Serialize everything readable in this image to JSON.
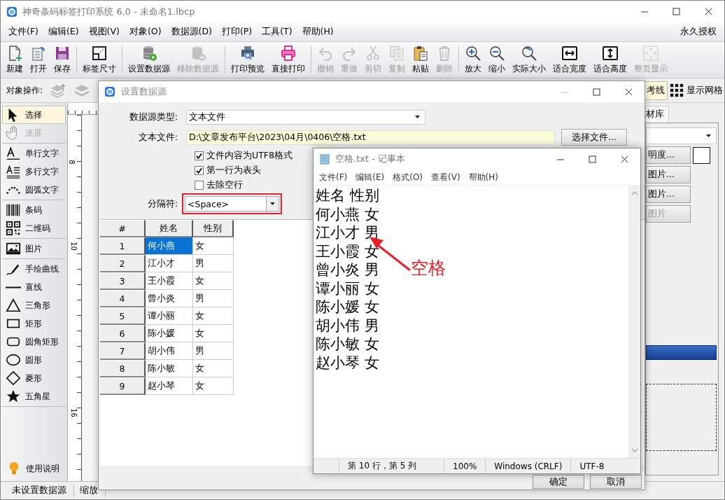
{
  "window": {
    "title": "神奇条码标签打印系统 6.0 - 未命名1.lbcp"
  },
  "menu": {
    "items": [
      "文件(F)",
      "编辑(E)",
      "视图(V)",
      "对象(O)",
      "数据源(D)",
      "打印(P)",
      "工具(T)",
      "帮助(H)"
    ],
    "license": "永久授权"
  },
  "toolbar": {
    "groups": [
      [
        {
          "label": "新建",
          "disabled": false
        },
        {
          "label": "打开",
          "disabled": false
        },
        {
          "label": "保存",
          "disabled": false
        }
      ],
      [
        {
          "label": "标签尺寸",
          "disabled": false
        }
      ],
      [
        {
          "label": "设置数据源",
          "disabled": false
        },
        {
          "label": "移除数据源",
          "disabled": true
        }
      ],
      [
        {
          "label": "打印预览",
          "disabled": false
        },
        {
          "label": "直接打印",
          "disabled": false
        }
      ],
      [
        {
          "label": "撤销",
          "disabled": true
        },
        {
          "label": "重做",
          "disabled": true
        },
        {
          "label": "剪切",
          "disabled": true
        },
        {
          "label": "复制",
          "disabled": true
        },
        {
          "label": "粘贴",
          "disabled": false
        },
        {
          "label": "删除",
          "disabled": true
        }
      ],
      [
        {
          "label": "放大",
          "disabled": false
        },
        {
          "label": "缩小",
          "disabled": false
        },
        {
          "label": "实际大小",
          "disabled": false
        },
        {
          "label": "适合宽度",
          "disabled": false
        },
        {
          "label": "适合高度",
          "disabled": false
        },
        {
          "label": "整页显示",
          "disabled": true
        }
      ]
    ]
  },
  "object_bar": {
    "label": "对象操作:",
    "guides_button": "考线",
    "grid_button": "显示网格"
  },
  "tools": {
    "groups": [
      [
        {
          "label": "选择",
          "selected": true,
          "disabled": false
        },
        {
          "label": "滚屏",
          "selected": false,
          "disabled": true
        }
      ],
      [
        {
          "label": "单行文字",
          "selected": false,
          "disabled": false
        },
        {
          "label": "多行文字",
          "selected": false,
          "disabled": false
        },
        {
          "label": "圆弧文字",
          "selected": false,
          "disabled": false
        }
      ],
      [
        {
          "label": "条码",
          "selected": false,
          "disabled": false
        },
        {
          "label": "二维码",
          "selected": false,
          "disabled": false
        }
      ],
      [
        {
          "label": "图片",
          "selected": false,
          "disabled": false
        }
      ],
      [
        {
          "label": "手绘曲线",
          "selected": false,
          "disabled": false
        },
        {
          "label": "直线",
          "selected": false,
          "disabled": false
        },
        {
          "label": "三角形",
          "selected": false,
          "disabled": false
        },
        {
          "label": "矩形",
          "selected": false,
          "disabled": false
        },
        {
          "label": "圆角矩形",
          "selected": false,
          "disabled": false
        },
        {
          "label": "圆形",
          "selected": false,
          "disabled": false
        },
        {
          "label": "菱形",
          "selected": false,
          "disabled": false
        },
        {
          "label": "五角星",
          "selected": false,
          "disabled": false
        }
      ]
    ],
    "help": "使用说明"
  },
  "ruler": {
    "labels": [
      "8",
      "10",
      "16"
    ]
  },
  "side_panel": {
    "tab": "材库",
    "buttons": [
      {
        "label": "明度...",
        "disabled": false
      },
      {
        "label": "图片...",
        "disabled": false
      },
      {
        "label": "图片...",
        "disabled": false
      },
      {
        "label": "图片",
        "disabled": true
      }
    ]
  },
  "status_bar": {
    "items": [
      "未设置数据源",
      "缩放"
    ]
  },
  "dialog": {
    "title": "设置数据源",
    "source_type": {
      "label": "数据源类型:",
      "value": "文本文件"
    },
    "file": {
      "label": "文本文件:",
      "value": "D:\\文章发布平台\\2023\\04月\\0406\\空格.txt",
      "button": "选择文件..."
    },
    "options": [
      {
        "label": "文件内容为UTF8格式",
        "checked": true
      },
      {
        "label": "第一行为表头",
        "checked": true
      },
      {
        "label": "去除空行",
        "checked": false
      }
    ],
    "separator": {
      "label": "分隔符:",
      "value": "<Space>",
      "highlighted": true
    },
    "grid": {
      "columns": [
        "#",
        "姓名",
        "性别"
      ],
      "rows": [
        {
          "cells": [
            "1",
            "何小燕",
            "女"
          ],
          "selected": true
        },
        {
          "cells": [
            "2",
            "江小才",
            "男"
          ],
          "selected": false
        },
        {
          "cells": [
            "3",
            "王小霞",
            "女"
          ],
          "selected": false
        },
        {
          "cells": [
            "4",
            "曾小炎",
            "男"
          ],
          "selected": false
        },
        {
          "cells": [
            "5",
            "谭小丽",
            "女"
          ],
          "selected": false
        },
        {
          "cells": [
            "6",
            "陈小媛",
            "女"
          ],
          "selected": false
        },
        {
          "cells": [
            "7",
            "胡小伟",
            "男"
          ],
          "selected": false
        },
        {
          "cells": [
            "8",
            "陈小敏",
            "女"
          ],
          "selected": false
        },
        {
          "cells": [
            "9",
            "赵小琴",
            "女"
          ],
          "selected": false
        }
      ]
    },
    "buttons": [
      "确定",
      "取消"
    ]
  },
  "notepad": {
    "title": "空格.txt - 记事本",
    "menu": [
      "文件(F)",
      "编辑(E)",
      "格式(O)",
      "查看(V)",
      "帮助(H)"
    ],
    "lines": [
      "姓名 性别",
      "何小燕 女",
      "江小才 男",
      "王小霞 女",
      "曾小炎 男",
      "谭小丽 女",
      "陈小媛 女",
      "胡小伟 男",
      "陈小敏 女",
      "赵小琴 女"
    ],
    "status": [
      "第 10 行，第 5 列",
      "100%",
      "Windows (CRLF)",
      "UTF-8"
    ]
  },
  "callout": {
    "text": "空格"
  }
}
